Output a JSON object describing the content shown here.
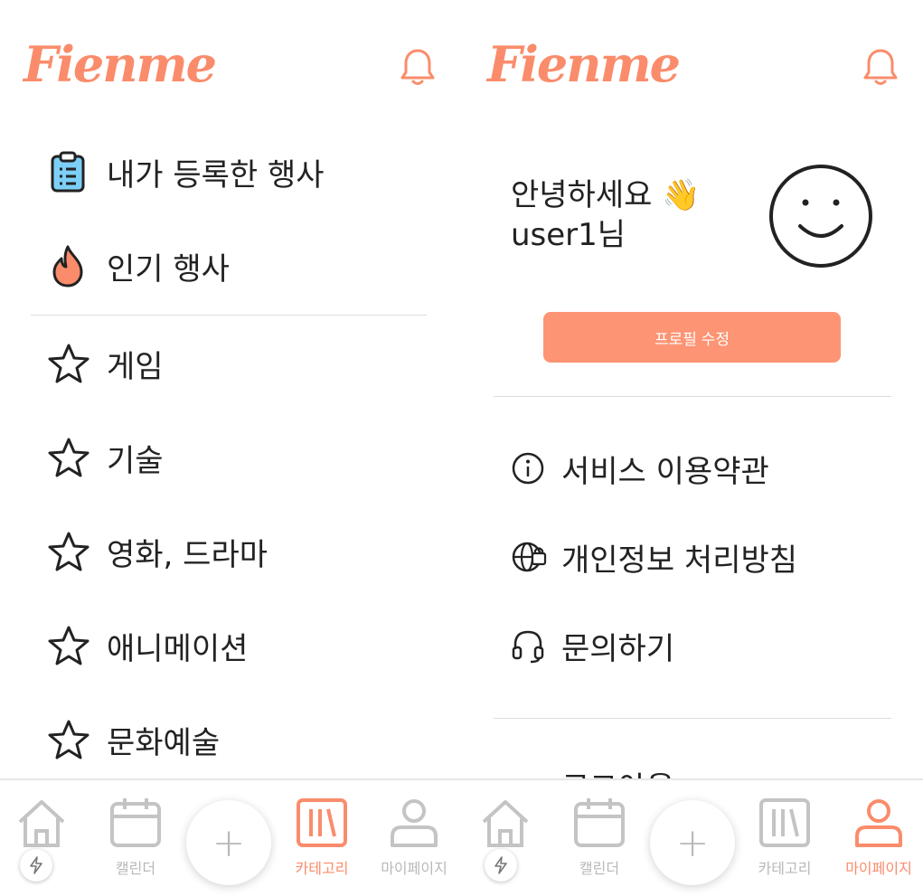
{
  "brand": {
    "logo_text": "Fienme",
    "accent_color": "#fa8c6b"
  },
  "categories_screen": {
    "top_items": [
      {
        "label": "내가 등록한 행사",
        "icon": "clipboard-icon"
      },
      {
        "label": "인기 행사",
        "icon": "fire-icon"
      }
    ],
    "category_items": [
      {
        "label": "게임",
        "icon": "star-icon"
      },
      {
        "label": "기술",
        "icon": "star-icon"
      },
      {
        "label": "영화, 드라마",
        "icon": "star-icon"
      },
      {
        "label": "애니메이션",
        "icon": "star-icon"
      },
      {
        "label": "문화예술",
        "icon": "star-icon"
      }
    ],
    "active_tab": "카테고리"
  },
  "mypage_screen": {
    "greeting_line1": "안녕하세요 👋",
    "greeting_line2": "user1님",
    "edit_profile_label": "프로필 수정",
    "menu": [
      {
        "label": "서비스 이용약관",
        "icon": "info-icon"
      },
      {
        "label": "개인정보 처리방침",
        "icon": "globe-lock-icon"
      },
      {
        "label": "문의하기",
        "icon": "headset-icon"
      }
    ],
    "logout_partial": "로그아웃",
    "active_tab": "마이페이지"
  },
  "tabbar": {
    "tabs": [
      {
        "label": "",
        "icon": "home-icon"
      },
      {
        "label": "캘린더",
        "icon": "calendar-icon"
      },
      {
        "label": "+",
        "icon": "plus-icon"
      },
      {
        "label": "카테고리",
        "icon": "category-icon"
      },
      {
        "label": "마이페이지",
        "icon": "person-icon"
      }
    ]
  }
}
